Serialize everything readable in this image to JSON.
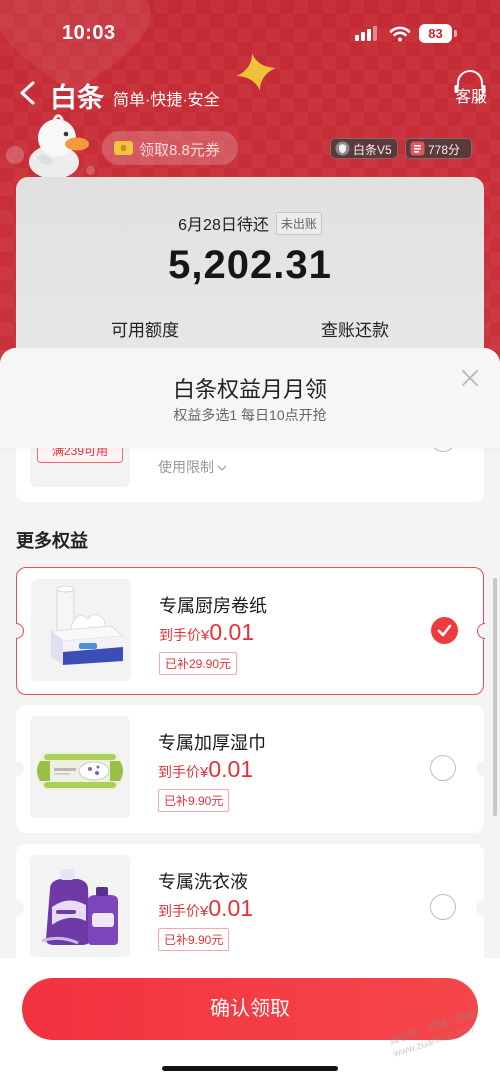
{
  "status_bar": {
    "time": "10:03",
    "battery_level": "83"
  },
  "header": {
    "back_icon": "chevron-left-icon",
    "title": "白条",
    "slogan": "简单·快捷·安全",
    "service_label": "客服",
    "service_icon": "headset-icon"
  },
  "promo": {
    "coupon_label": "领取8.8元券",
    "level_badge": "白条V5",
    "score_badge": "778分"
  },
  "bill_card": {
    "due_label": "6月28日待还",
    "status_tag": "未出账",
    "amount": "5,202.31",
    "credit_label": "可用额度",
    "repay_label": "查账还款"
  },
  "sheet": {
    "title": "白条权益月月领",
    "subtitle": "权益多选1 每日10点开抢",
    "close_icon": "close-icon",
    "partial_item": {
      "coupon_text": "满239可用",
      "limit_label": "使用限制"
    },
    "section_title": "更多权益",
    "items": [
      {
        "name": "专属厨房卷纸",
        "price_label": "到手价",
        "currency": "¥",
        "price": "0.01",
        "subsidy": "已补29.90元",
        "selected": true,
        "image": "kitchen-paper-image"
      },
      {
        "name": "专属加厚湿巾",
        "price_label": "到手价",
        "currency": "¥",
        "price": "0.01",
        "subsidy": "已补9.90元",
        "selected": false,
        "image": "wet-wipes-image"
      },
      {
        "name": "专属洗衣液",
        "price_label": "到手价",
        "currency": "¥",
        "price": "0.01",
        "subsidy": "已补9.90元",
        "selected": false,
        "image": "laundry-detergent-image"
      }
    ]
  },
  "confirm_button": {
    "label": "确认领取"
  },
  "watermark": {
    "line1": "赚客吧，有赚一起赚！",
    "line2": "www.zuanke8.com"
  },
  "colors": {
    "brand_red": "#f23b44",
    "price_red": "#e53238",
    "background_red": "#c62d36"
  }
}
